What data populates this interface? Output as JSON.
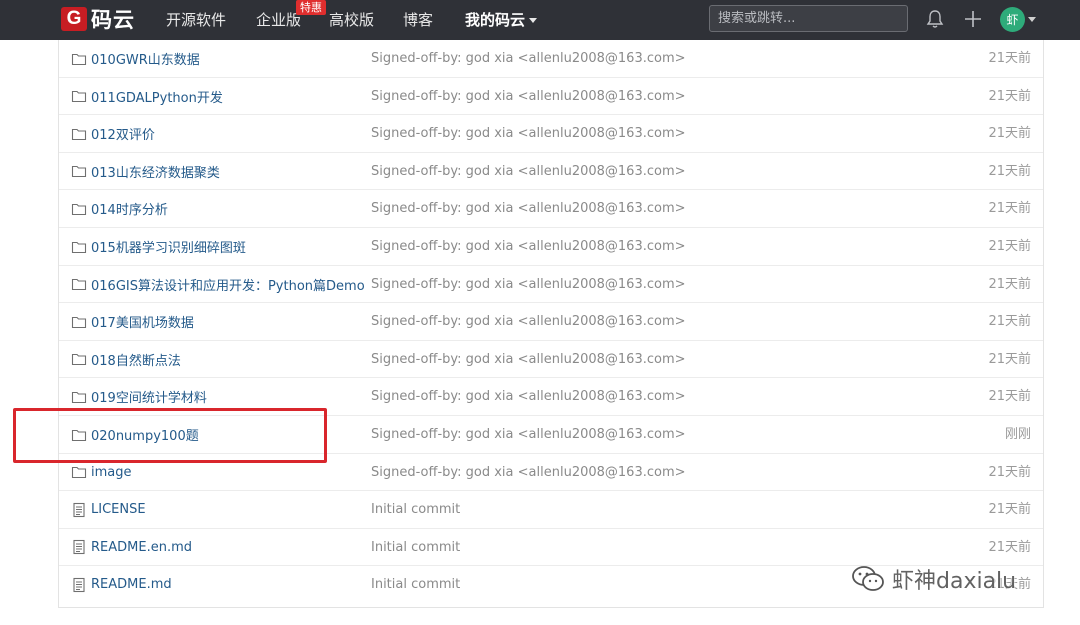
{
  "navbar": {
    "logo_mark": "G",
    "logo_text": "码云",
    "items": [
      {
        "label": "开源软件"
      },
      {
        "label": "企业版",
        "badge": "特惠"
      },
      {
        "label": "高校版"
      },
      {
        "label": "博客"
      },
      {
        "label": "我的码云"
      }
    ],
    "search_placeholder": "搜索或跳转...",
    "avatar_text": "虾",
    "icons": [
      "bell-icon",
      "plus-icon"
    ]
  },
  "file_list": {
    "rows": [
      {
        "type": "folder",
        "name": "010GWR山东数据",
        "message": "Signed-off-by: god xia <allenlu2008@163.com>",
        "time": "21天前"
      },
      {
        "type": "folder",
        "name": "011GDALPython开发",
        "message": "Signed-off-by: god xia <allenlu2008@163.com>",
        "time": "21天前"
      },
      {
        "type": "folder",
        "name": "012双评价",
        "message": "Signed-off-by: god xia <allenlu2008@163.com>",
        "time": "21天前"
      },
      {
        "type": "folder",
        "name": "013山东经济数据聚类",
        "message": "Signed-off-by: god xia <allenlu2008@163.com>",
        "time": "21天前"
      },
      {
        "type": "folder",
        "name": "014时序分析",
        "message": "Signed-off-by: god xia <allenlu2008@163.com>",
        "time": "21天前"
      },
      {
        "type": "folder",
        "name": "015机器学习识别细碎图斑",
        "message": "Signed-off-by: god xia <allenlu2008@163.com>",
        "time": "21天前"
      },
      {
        "type": "folder",
        "name": "016GIS算法设计和应用开发：Python篇Demo",
        "message": "Signed-off-by: god xia <allenlu2008@163.com>",
        "time": "21天前"
      },
      {
        "type": "folder",
        "name": "017美国机场数据",
        "message": "Signed-off-by: god xia <allenlu2008@163.com>",
        "time": "21天前"
      },
      {
        "type": "folder",
        "name": "018自然断点法",
        "message": "Signed-off-by: god xia <allenlu2008@163.com>",
        "time": "21天前"
      },
      {
        "type": "folder",
        "name": "019空间统计学材料",
        "message": "Signed-off-by: god xia <allenlu2008@163.com>",
        "time": "21天前"
      },
      {
        "type": "folder",
        "name": "020numpy100题",
        "message": "Signed-off-by: god xia <allenlu2008@163.com>",
        "time": "刚刚"
      },
      {
        "type": "folder",
        "name": "image",
        "message": "Signed-off-by: god xia <allenlu2008@163.com>",
        "time": "21天前"
      },
      {
        "type": "file",
        "name": "LICENSE",
        "message": "Initial commit",
        "time": "21天前"
      },
      {
        "type": "file",
        "name": "README.en.md",
        "message": "Initial commit",
        "time": "21天前"
      },
      {
        "type": "file",
        "name": "README.md",
        "message": "Initial commit",
        "time": "21天前"
      }
    ]
  },
  "annotation": {
    "color": "#d9262c"
  },
  "watermark": {
    "text": "虾神daxialu"
  },
  "colors": {
    "navbar_bg": "#2f3137",
    "link": "#245a8a",
    "brand_red": "#c71d23",
    "avatar_bg": "#2eab7a"
  }
}
